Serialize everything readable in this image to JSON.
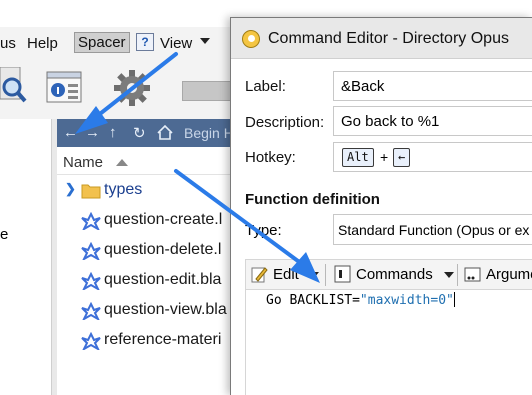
{
  "background_window": {
    "menu": {
      "items": [
        "us",
        "Help",
        "Spacer",
        "View"
      ]
    },
    "navbar": {
      "begin_text": "Begin H"
    },
    "left_pane": {
      "fragment": "e"
    },
    "column_header": {
      "name": "Name"
    },
    "files": [
      {
        "label": "types",
        "kind": "folder"
      },
      {
        "label": "question-create.l",
        "kind": "blade"
      },
      {
        "label": "question-delete.l",
        "kind": "blade"
      },
      {
        "label": "question-edit.bla",
        "kind": "blade"
      },
      {
        "label": "question-view.bla",
        "kind": "blade"
      },
      {
        "label": "reference-materi",
        "kind": "blade"
      }
    ]
  },
  "dialog": {
    "title": "Command Editor - Directory Opus",
    "label_caption": "Label:",
    "label_value": "&Back",
    "description_caption": "Description:",
    "description_value": "Go back to %1",
    "hotkey_caption": "Hotkey:",
    "hotkey": {
      "key1": "Alt",
      "plus": "+",
      "key2": "←"
    },
    "function_section": "Function definition",
    "type_caption": "Type:",
    "type_value": "Standard Function (Opus or ex",
    "toolbar": {
      "edit": "Edit",
      "commands": "Commands",
      "arguments": "Argume"
    },
    "code": {
      "command": "Go BACKLIST=",
      "string": "\"maxwidth=0\""
    }
  },
  "colors": {
    "navbar": "#4d6a93",
    "arrow": "#2b7be8",
    "code_string": "#1f6fb0",
    "folder": "#f2c14e"
  }
}
